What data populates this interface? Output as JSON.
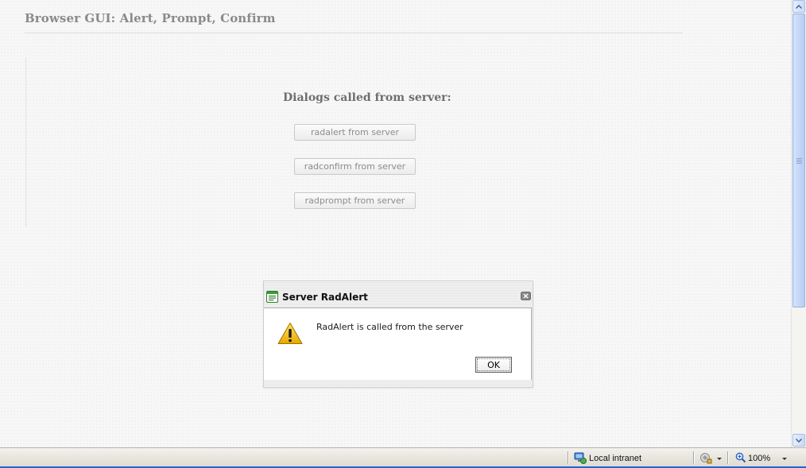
{
  "page": {
    "title": "Browser GUI: Alert, Prompt, Confirm",
    "section_heading": "Dialogs called from server:",
    "buttons": [
      {
        "label": "radalert from server"
      },
      {
        "label": "radconfirm from server"
      },
      {
        "label": "radprompt from server"
      }
    ]
  },
  "dialog": {
    "title": "Server RadAlert",
    "message": "RadAlert is called from the server",
    "ok_label": "OK",
    "icons": {
      "title": "dialog-window-icon",
      "close": "close-icon",
      "body": "warning-icon"
    }
  },
  "statusbar": {
    "zone_label": "Local intranet",
    "zoom_label": "100%"
  },
  "colors": {
    "accent": "#2a63c9",
    "scrollbar": "#b8cdf4",
    "warning": "#f2c200"
  }
}
